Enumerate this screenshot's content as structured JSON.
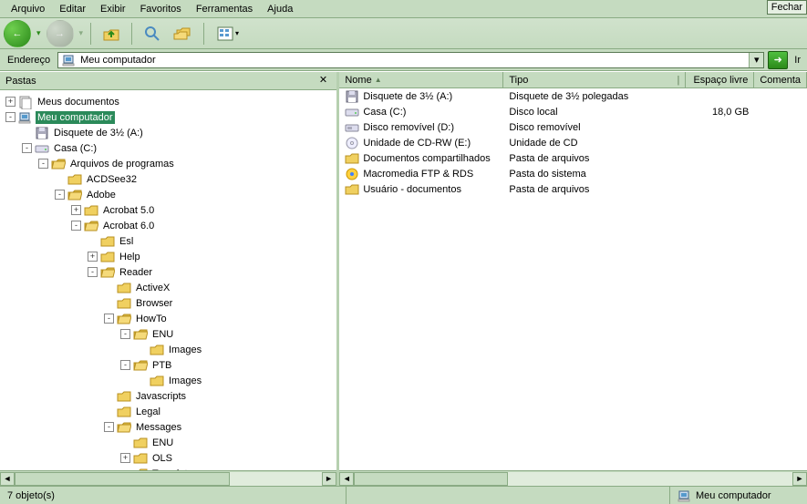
{
  "menubar": {
    "items": [
      "Arquivo",
      "Editar",
      "Exibir",
      "Favoritos",
      "Ferramentas",
      "Ajuda"
    ],
    "fechar": "Fechar"
  },
  "toolbar": {
    "back": "←",
    "forward": "→"
  },
  "address": {
    "label": "Endereço",
    "value": "Meu computador",
    "go": "Ir"
  },
  "pastas": {
    "title": "Pastas"
  },
  "tree": [
    {
      "indent": 0,
      "twisty": "+",
      "icon": "docs",
      "label": "Meus documentos"
    },
    {
      "indent": 0,
      "twisty": "-",
      "icon": "computer",
      "label": "Meu computador",
      "selected": true
    },
    {
      "indent": 1,
      "twisty": " ",
      "icon": "floppy",
      "label": "Disquete de 3½ (A:)"
    },
    {
      "indent": 1,
      "twisty": "-",
      "icon": "drive",
      "label": "Casa (C:)"
    },
    {
      "indent": 2,
      "twisty": "-",
      "icon": "folder-open",
      "label": "Arquivos de programas"
    },
    {
      "indent": 3,
      "twisty": " ",
      "icon": "folder",
      "label": "ACDSee32"
    },
    {
      "indent": 3,
      "twisty": "-",
      "icon": "folder-open",
      "label": "Adobe"
    },
    {
      "indent": 4,
      "twisty": "+",
      "icon": "folder",
      "label": "Acrobat 5.0"
    },
    {
      "indent": 4,
      "twisty": "-",
      "icon": "folder-open",
      "label": "Acrobat 6.0"
    },
    {
      "indent": 5,
      "twisty": " ",
      "icon": "folder",
      "label": "Esl"
    },
    {
      "indent": 5,
      "twisty": "+",
      "icon": "folder",
      "label": "Help"
    },
    {
      "indent": 5,
      "twisty": "-",
      "icon": "folder-open",
      "label": "Reader"
    },
    {
      "indent": 6,
      "twisty": " ",
      "icon": "folder",
      "label": "ActiveX"
    },
    {
      "indent": 6,
      "twisty": " ",
      "icon": "folder",
      "label": "Browser"
    },
    {
      "indent": 6,
      "twisty": "-",
      "icon": "folder-open",
      "label": "HowTo"
    },
    {
      "indent": 7,
      "twisty": "-",
      "icon": "folder-open",
      "label": "ENU"
    },
    {
      "indent": 8,
      "twisty": " ",
      "icon": "folder",
      "label": "Images"
    },
    {
      "indent": 7,
      "twisty": "-",
      "icon": "folder-open",
      "label": "PTB"
    },
    {
      "indent": 8,
      "twisty": " ",
      "icon": "folder",
      "label": "Images"
    },
    {
      "indent": 6,
      "twisty": " ",
      "icon": "folder",
      "label": "Javascripts"
    },
    {
      "indent": 6,
      "twisty": " ",
      "icon": "folder",
      "label": "Legal"
    },
    {
      "indent": 6,
      "twisty": "-",
      "icon": "folder-open",
      "label": "Messages"
    },
    {
      "indent": 7,
      "twisty": " ",
      "icon": "folder",
      "label": "ENU"
    },
    {
      "indent": 7,
      "twisty": "+",
      "icon": "folder",
      "label": "OLS"
    },
    {
      "indent": 7,
      "twisty": " ",
      "icon": "folder",
      "label": "Templates"
    }
  ],
  "columns": {
    "name": "Nome",
    "tipo": "Tipo",
    "esp": "Espaço livre",
    "com": "Comenta"
  },
  "rows": [
    {
      "icon": "floppy",
      "name": "Disquete de 3½ (A:)",
      "tipo": "Disquete de 3½ polegadas",
      "esp": ""
    },
    {
      "icon": "drive",
      "name": "Casa (C:)",
      "tipo": "Disco local",
      "esp": "18,0 GB"
    },
    {
      "icon": "removable",
      "name": "Disco removível (D:)",
      "tipo": "Disco removível",
      "esp": ""
    },
    {
      "icon": "cd",
      "name": "Unidade de CD-RW (E:)",
      "tipo": "Unidade de CD",
      "esp": ""
    },
    {
      "icon": "folder",
      "name": "Documentos compartilhados",
      "tipo": "Pasta de arquivos",
      "esp": ""
    },
    {
      "icon": "sys",
      "name": "Macromedia FTP & RDS",
      "tipo": "Pasta do sistema",
      "esp": ""
    },
    {
      "icon": "folder",
      "name": "Usuário - documentos",
      "tipo": "Pasta de arquivos",
      "esp": ""
    }
  ],
  "status": {
    "objects": "7 objeto(s)",
    "location": "Meu computador"
  }
}
